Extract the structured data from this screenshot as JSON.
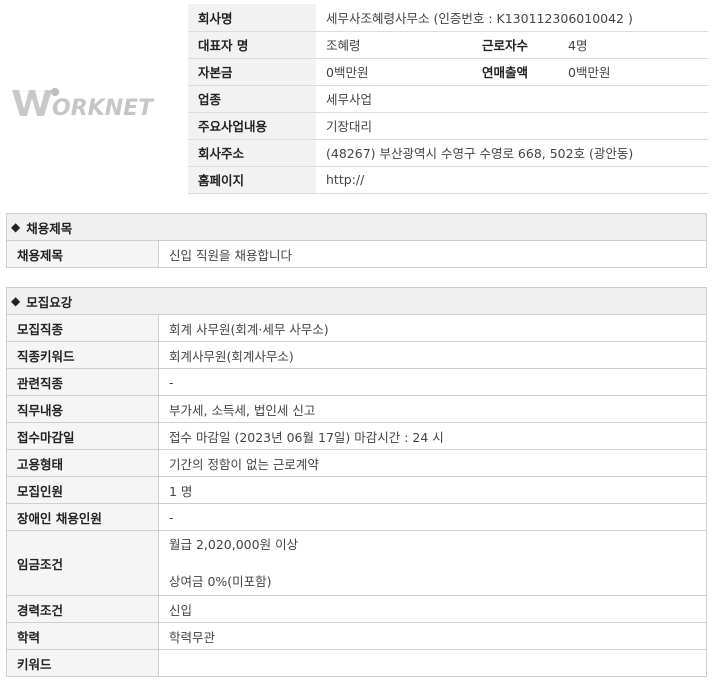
{
  "company": {
    "logo_text": "WORKNET",
    "rows": [
      {
        "label": "회사명",
        "value": "세무사조혜령사무소 (인증번호 : K130112306010042 )"
      },
      {
        "label": "대표자 명",
        "value": "조혜령",
        "label2": "근로자수",
        "value2": "4명"
      },
      {
        "label": "자본금",
        "value": "0백만원",
        "label2": "연매출액",
        "value2": "0백만원"
      },
      {
        "label": "업종",
        "value": "세무사업"
      },
      {
        "label": "주요사업내용",
        "value": "기장대리"
      },
      {
        "label": "회사주소",
        "value": "(48267) 부산광역시 수영구 수영로 668, 502호 (광안동)"
      },
      {
        "label": "홈페이지",
        "value": "http://"
      }
    ]
  },
  "recruit_title": {
    "heading": "채용제목",
    "label": "채용제목",
    "value": "신입 직원을 채용합니다"
  },
  "requirements": {
    "heading": "모집요강",
    "rows": [
      {
        "label": "모집직종",
        "value": "회계 사무원(회계·세무 사무소)"
      },
      {
        "label": "직종키워드",
        "value": "회계사무원(회계사무소)"
      },
      {
        "label": "관련직종",
        "value": "-"
      },
      {
        "label": "직무내용",
        "value": "부가세, 소득세, 법인세 신고"
      },
      {
        "label": "접수마감일",
        "value": "접수 마감일 (2023년 06월 17일) 마감시간 : 24 시"
      },
      {
        "label": "고용형태",
        "value": "기간의 정함이 없는 근로계약"
      },
      {
        "label": "모집인원",
        "value": "1 명"
      },
      {
        "label": "장애인 채용인원",
        "value": "-"
      },
      {
        "label": "임금조건",
        "value": "월급 2,020,000원 이상",
        "value_extra": "상여금 0%(미포함)"
      },
      {
        "label": "경력조건",
        "value": "신입"
      },
      {
        "label": "학력",
        "value": "학력무관"
      },
      {
        "label": "키워드",
        "value": ""
      }
    ]
  }
}
